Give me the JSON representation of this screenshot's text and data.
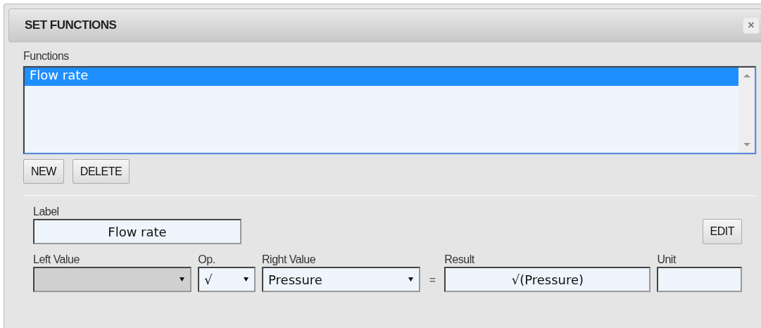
{
  "window": {
    "title": "SET FUNCTIONS",
    "close": "×"
  },
  "functions": {
    "label": "Functions",
    "items": [
      {
        "text": "Flow rate",
        "selected": true
      }
    ],
    "buttons": [
      "NEW",
      "DELETE"
    ]
  },
  "editor": {
    "label_caption": "Label",
    "label_value": "Flow rate",
    "edit_button": "EDIT",
    "fields": [
      {
        "kind": "select",
        "caption": "Left Value",
        "disabled": true
      },
      {
        "kind": "select",
        "caption": "Op.",
        "value": "√",
        "disabled": false
      },
      {
        "kind": "select",
        "caption": "Right Value",
        "value": "Pressure",
        "disabled": false
      },
      {
        "kind": "equals",
        "value": "="
      },
      {
        "kind": "text",
        "caption": "Result",
        "value": "√(Pressure)",
        "disabled": false
      },
      {
        "kind": "text",
        "caption": "Unit",
        "disabled": false
      }
    ]
  }
}
